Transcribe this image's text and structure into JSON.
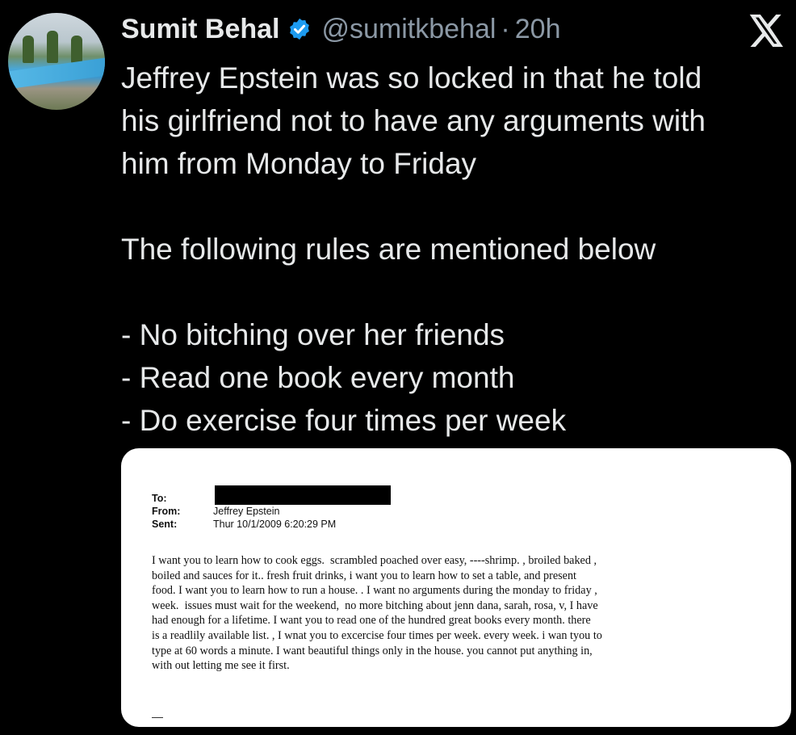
{
  "author": {
    "name": "Sumit Behal",
    "handle": "@sumitkbehal",
    "separator": "·",
    "time": "20h"
  },
  "icons": {
    "verified": "verified-badge-icon",
    "platform": "x-logo-icon",
    "accent": "#1d9bf0"
  },
  "tweet": {
    "text": "Jeffrey Epstein was so locked in that he told\nhis girlfriend not to have any arguments with\nhim from Monday to Friday\n\nThe following rules are mentioned below\n\n- No bitching over her friends\n- Read one book every month\n- Do exercise four times per week"
  },
  "email": {
    "to_label": "To:",
    "from_label": "From:",
    "from_value": "Jeffrey Epstein",
    "sent_label": "Sent:",
    "sent_value": "Thur 10/1/2009 6:20:29 PM",
    "body": "I want you to learn how to cook eggs.  scrambled poached over easy, ----shrimp. , broiled baked ,\nboiled and sauces for it.. fresh fruit drinks, i want you to learn how to set a table, and present\nfood. I want you to learn how to run a house. . I want no arguments during the monday to friday ,\nweek.  issues must wait for the weekend,  no more bitching about jenn dana, sarah, rosa, v, I have\nhad enough for a lifetime. I want you to read one of the hundred great books every month. there\nis a readlily available list. , I wnat you to excercise four times per week. every week. i wan tyou to\ntype at 60 words a minute. I want beautiful things only in the house. you cannot put anything in,\nwith out letting me see it first."
  }
}
